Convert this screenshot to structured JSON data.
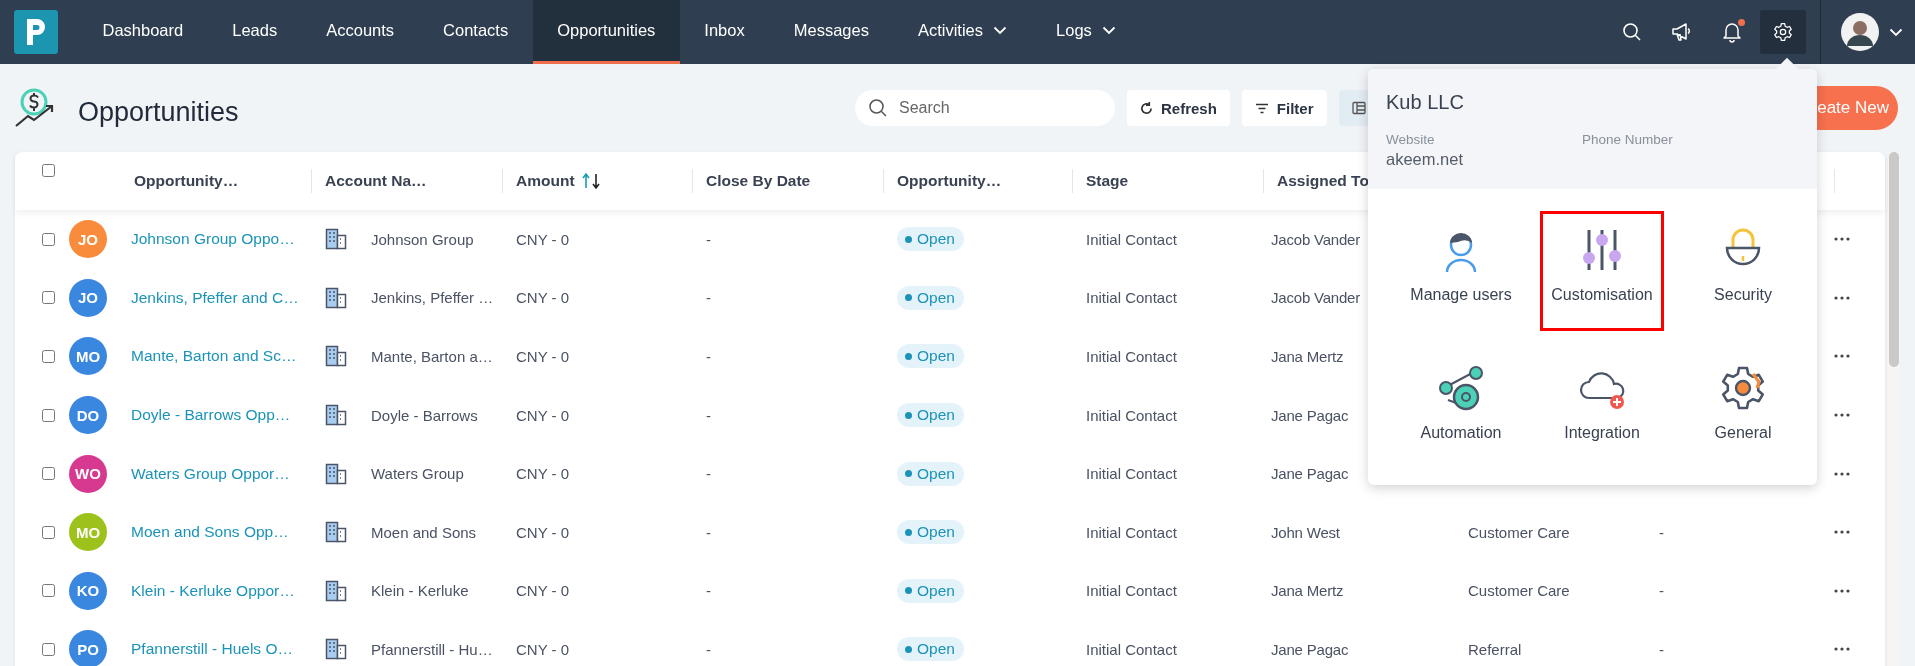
{
  "nav": {
    "items": [
      {
        "label": "Dashboard",
        "selected": false,
        "dropdown": false
      },
      {
        "label": "Leads",
        "selected": false,
        "dropdown": false
      },
      {
        "label": "Accounts",
        "selected": false,
        "dropdown": false
      },
      {
        "label": "Contacts",
        "selected": false,
        "dropdown": false
      },
      {
        "label": "Opportunities",
        "selected": true,
        "dropdown": false
      },
      {
        "label": "Inbox",
        "selected": false,
        "dropdown": false
      },
      {
        "label": "Messages",
        "selected": false,
        "dropdown": false
      },
      {
        "label": "Activities",
        "selected": false,
        "dropdown": true
      },
      {
        "label": "Logs",
        "selected": false,
        "dropdown": true
      }
    ],
    "notifications_unread": true,
    "settings_open": true
  },
  "page": {
    "title": "Opportunities"
  },
  "toolbar": {
    "search": {
      "placeholder": "Search"
    },
    "buttons": [
      {
        "kind": "refresh",
        "label": "Refresh"
      },
      {
        "kind": "filter",
        "label": "Filter"
      },
      {
        "kind": "columns"
      },
      {
        "kind": "create",
        "label": "eate New"
      }
    ]
  },
  "table": {
    "select_all": {
      "checked": false
    },
    "columns": [
      {
        "label": "Opportunity…",
        "sorted_ascending": false
      },
      {
        "label": "Account Na…",
        "sorted_ascending": false
      },
      {
        "label": "Amount",
        "sorted_ascending": true
      },
      {
        "label": "Close By Date",
        "sorted_ascending": false
      },
      {
        "label": "Opportunity…",
        "sorted_ascending": false
      },
      {
        "label": "Stage",
        "sorted_ascending": false
      },
      {
        "label": "Assigned To",
        "sorted_ascending": false
      }
    ],
    "rows": [
      {
        "checked": false,
        "initials": "JO",
        "color": "#f98b3d",
        "name": "Johnson Group Oppo…",
        "account": "Johnson Group",
        "amount": "CNY - 0",
        "close_date": "-",
        "status": "Open",
        "stage": "Initial Contact",
        "assigned_to": "Jacob Vander"
      },
      {
        "checked": false,
        "initials": "JO",
        "color": "#3a87e0",
        "name": "Jenkins, Pfeffer and C…",
        "account": "Jenkins, Pfeffer …",
        "amount": "CNY - 0",
        "close_date": "-",
        "status": "Open",
        "stage": "Initial Contact",
        "assigned_to": "Jacob Vander"
      },
      {
        "checked": false,
        "initials": "MO",
        "color": "#3a87e0",
        "name": "Mante, Barton and Sc…",
        "account": "Mante, Barton a…",
        "amount": "CNY - 0",
        "close_date": "-",
        "status": "Open",
        "stage": "Initial Contact",
        "assigned_to": "Jana Mertz"
      },
      {
        "checked": false,
        "initials": "DO",
        "color": "#3a87e0",
        "name": "Doyle - Barrows Opp…",
        "account": "Doyle - Barrows",
        "amount": "CNY - 0",
        "close_date": "-",
        "status": "Open",
        "stage": "Initial Contact",
        "assigned_to": "Jane Pagac"
      },
      {
        "checked": false,
        "initials": "WO",
        "color": "#d6398f",
        "name": "Waters Group Oppor…",
        "account": "Waters Group",
        "amount": "CNY - 0",
        "close_date": "-",
        "status": "Open",
        "stage": "Initial Contact",
        "assigned_to": "Jane Pagac"
      },
      {
        "checked": false,
        "initials": "MO",
        "color": "#9dc21b",
        "name": "Moen and Sons Opp…",
        "account": "Moen and Sons",
        "amount": "CNY - 0",
        "close_date": "-",
        "status": "Open",
        "stage": "Initial Contact",
        "assigned_to": "John West",
        "column_8": "Customer Care",
        "column_9": "-"
      },
      {
        "checked": false,
        "initials": "KO",
        "color": "#3a87e0",
        "name": "Klein - Kerluke Oppor…",
        "account": "Klein - Kerluke",
        "amount": "CNY - 0",
        "close_date": "-",
        "status": "Open",
        "stage": "Initial Contact",
        "assigned_to": "Jana Mertz",
        "column_8": "Customer Care",
        "column_9": "-"
      },
      {
        "checked": false,
        "initials": "PO",
        "color": "#3a87e0",
        "name": "Pfannerstill - Huels O…",
        "account": "Pfannerstill - Hu…",
        "amount": "CNY - 0",
        "close_date": "-",
        "status": "Open",
        "stage": "Initial Contact",
        "assigned_to": "Jane Pagac",
        "column_8": "Referral",
        "column_9": "-"
      }
    ]
  },
  "settings_menu": {
    "company": "Kub LLC",
    "fields": [
      {
        "label": "Website",
        "value": "akeem.net"
      },
      {
        "label": "Phone Number"
      }
    ],
    "items": [
      {
        "kind": "users",
        "label": "Manage users",
        "selected": false
      },
      {
        "kind": "sliders",
        "label": "Customisation",
        "selected": true
      },
      {
        "kind": "lock",
        "label": "Security",
        "selected": false
      },
      {
        "kind": "automation",
        "label": "Automation",
        "selected": false
      },
      {
        "kind": "cloud",
        "label": "Integration",
        "selected": false
      },
      {
        "kind": "gear",
        "label": "General",
        "selected": false
      }
    ]
  }
}
